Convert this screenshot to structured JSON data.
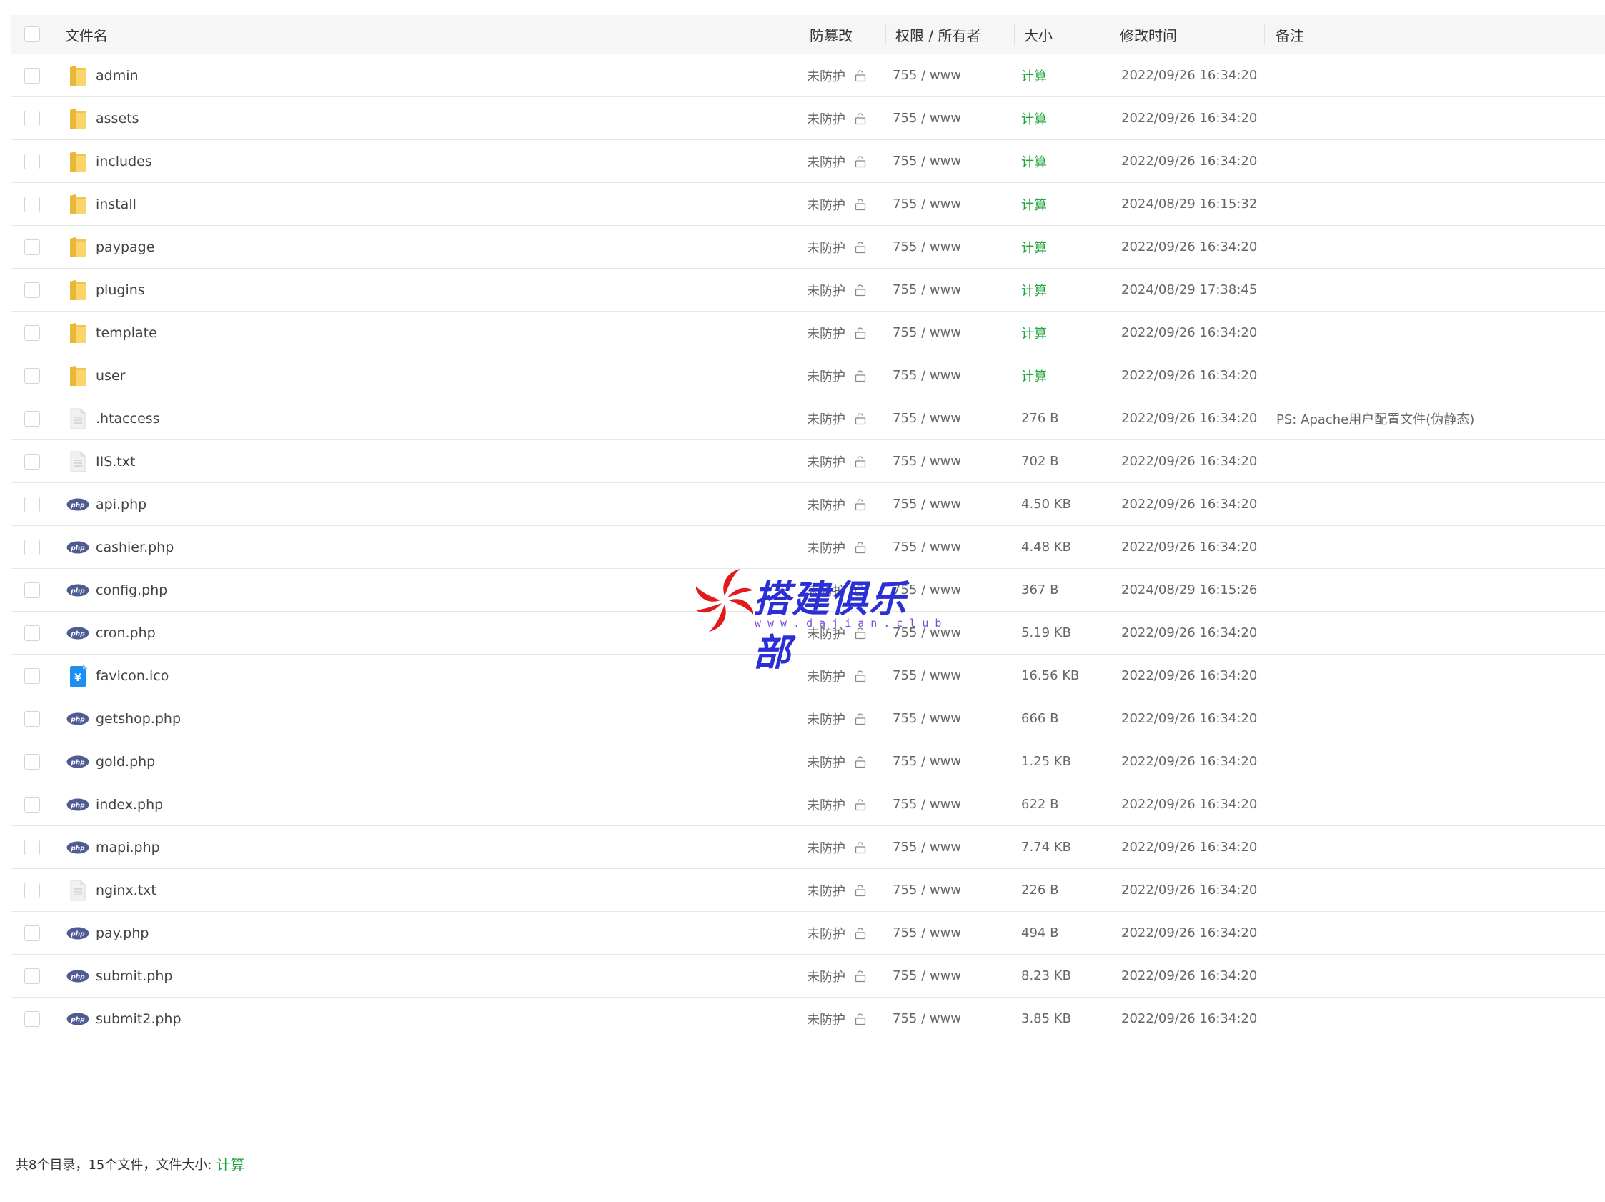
{
  "colors": {
    "accent_green": "#20a53a",
    "php_badge": "#4f5b93",
    "folder": "#f5c842",
    "ico_blue": "#1e8ff0",
    "watermark_blue": "#2b2fd6",
    "watermark_red": "#e21a1a"
  },
  "header": {
    "name": "文件名",
    "protection": "防篡改",
    "permission": "权限 / 所有者",
    "size": "大小",
    "modified": "修改时间",
    "note": "备注"
  },
  "rows": [
    {
      "name": "admin",
      "icon": "folder-icon",
      "protection": "未防护",
      "permission": "755 / www",
      "size": "计算",
      "size_is_calc": true,
      "modified": "2022/09/26 16:34:20",
      "note": ""
    },
    {
      "name": "assets",
      "icon": "folder-icon",
      "protection": "未防护",
      "permission": "755 / www",
      "size": "计算",
      "size_is_calc": true,
      "modified": "2022/09/26 16:34:20",
      "note": ""
    },
    {
      "name": "includes",
      "icon": "folder-icon",
      "protection": "未防护",
      "permission": "755 / www",
      "size": "计算",
      "size_is_calc": true,
      "modified": "2022/09/26 16:34:20",
      "note": ""
    },
    {
      "name": "install",
      "icon": "folder-icon",
      "protection": "未防护",
      "permission": "755 / www",
      "size": "计算",
      "size_is_calc": true,
      "modified": "2024/08/29 16:15:32",
      "note": ""
    },
    {
      "name": "paypage",
      "icon": "folder-icon",
      "protection": "未防护",
      "permission": "755 / www",
      "size": "计算",
      "size_is_calc": true,
      "modified": "2022/09/26 16:34:20",
      "note": ""
    },
    {
      "name": "plugins",
      "icon": "folder-icon",
      "protection": "未防护",
      "permission": "755 / www",
      "size": "计算",
      "size_is_calc": true,
      "modified": "2024/08/29 17:38:45",
      "note": ""
    },
    {
      "name": "template",
      "icon": "folder-icon",
      "protection": "未防护",
      "permission": "755 / www",
      "size": "计算",
      "size_is_calc": true,
      "modified": "2022/09/26 16:34:20",
      "note": ""
    },
    {
      "name": "user",
      "icon": "folder-icon",
      "protection": "未防护",
      "permission": "755 / www",
      "size": "计算",
      "size_is_calc": true,
      "modified": "2022/09/26 16:34:20",
      "note": ""
    },
    {
      "name": ".htaccess",
      "icon": "text-file-icon",
      "protection": "未防护",
      "permission": "755 / www",
      "size": "276 B",
      "size_is_calc": false,
      "modified": "2022/09/26 16:34:20",
      "note": "PS: Apache用户配置文件(伪静态)"
    },
    {
      "name": "IIS.txt",
      "icon": "text-file-icon",
      "protection": "未防护",
      "permission": "755 / www",
      "size": "702 B",
      "size_is_calc": false,
      "modified": "2022/09/26 16:34:20",
      "note": ""
    },
    {
      "name": "api.php",
      "icon": "php-file-icon",
      "protection": "未防护",
      "permission": "755 / www",
      "size": "4.50 KB",
      "size_is_calc": false,
      "modified": "2022/09/26 16:34:20",
      "note": ""
    },
    {
      "name": "cashier.php",
      "icon": "php-file-icon",
      "protection": "未防护",
      "permission": "755 / www",
      "size": "4.48 KB",
      "size_is_calc": false,
      "modified": "2022/09/26 16:34:20",
      "note": ""
    },
    {
      "name": "config.php",
      "icon": "php-file-icon",
      "protection": "未防护",
      "permission": "755 / www",
      "size": "367 B",
      "size_is_calc": false,
      "modified": "2024/08/29 16:15:26",
      "note": ""
    },
    {
      "name": "cron.php",
      "icon": "php-file-icon",
      "protection": "未防护",
      "permission": "755 / www",
      "size": "5.19 KB",
      "size_is_calc": false,
      "modified": "2022/09/26 16:34:20",
      "note": ""
    },
    {
      "name": "favicon.ico",
      "icon": "ico-file-icon",
      "protection": "未防护",
      "permission": "755 / www",
      "size": "16.56 KB",
      "size_is_calc": false,
      "modified": "2022/09/26 16:34:20",
      "note": ""
    },
    {
      "name": "getshop.php",
      "icon": "php-file-icon",
      "protection": "未防护",
      "permission": "755 / www",
      "size": "666 B",
      "size_is_calc": false,
      "modified": "2022/09/26 16:34:20",
      "note": ""
    },
    {
      "name": "gold.php",
      "icon": "php-file-icon",
      "protection": "未防护",
      "permission": "755 / www",
      "size": "1.25 KB",
      "size_is_calc": false,
      "modified": "2022/09/26 16:34:20",
      "note": ""
    },
    {
      "name": "index.php",
      "icon": "php-file-icon",
      "protection": "未防护",
      "permission": "755 / www",
      "size": "622 B",
      "size_is_calc": false,
      "modified": "2022/09/26 16:34:20",
      "note": ""
    },
    {
      "name": "mapi.php",
      "icon": "php-file-icon",
      "protection": "未防护",
      "permission": "755 / www",
      "size": "7.74 KB",
      "size_is_calc": false,
      "modified": "2022/09/26 16:34:20",
      "note": ""
    },
    {
      "name": "nginx.txt",
      "icon": "text-file-icon",
      "protection": "未防护",
      "permission": "755 / www",
      "size": "226 B",
      "size_is_calc": false,
      "modified": "2022/09/26 16:34:20",
      "note": ""
    },
    {
      "name": "pay.php",
      "icon": "php-file-icon",
      "protection": "未防护",
      "permission": "755 / www",
      "size": "494 B",
      "size_is_calc": false,
      "modified": "2022/09/26 16:34:20",
      "note": ""
    },
    {
      "name": "submit.php",
      "icon": "php-file-icon",
      "protection": "未防护",
      "permission": "755 / www",
      "size": "8.23 KB",
      "size_is_calc": false,
      "modified": "2022/09/26 16:34:20",
      "note": ""
    },
    {
      "name": "submit2.php",
      "icon": "php-file-icon",
      "protection": "未防护",
      "permission": "755 / www",
      "size": "3.85 KB",
      "size_is_calc": false,
      "modified": "2022/09/26 16:34:20",
      "note": ""
    }
  ],
  "footer": {
    "summary": "共8个目录，15个文件，文件大小:",
    "calc_link": "计算"
  },
  "watermark": {
    "title": "搭建俱乐部",
    "url": "www.dajian.club"
  }
}
